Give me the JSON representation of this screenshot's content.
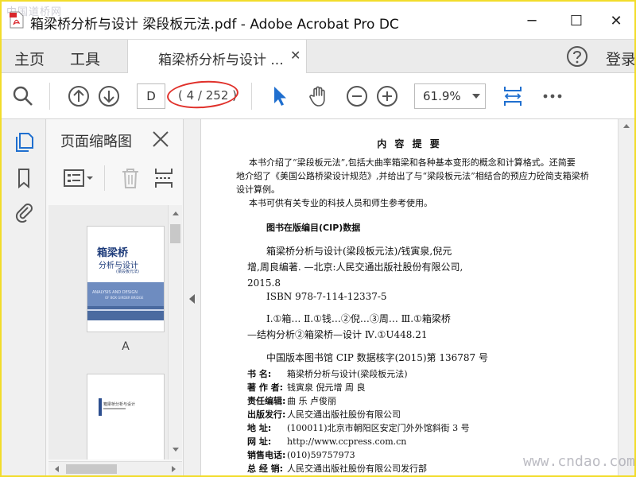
{
  "watermark_top": "中国道桥网",
  "watermark_bottom": "www.cndao.com",
  "window": {
    "title": "箱梁桥分析与设计 梁段板元法.pdf - Adobe Acrobat Pro DC",
    "minimize": "─",
    "maximize": "☐",
    "close": "✕"
  },
  "menubar": {
    "home": "主页",
    "tools": "工具",
    "doc_tab": "箱梁桥分析与设计 ...",
    "doc_tab_close": "✕",
    "signin": "登录"
  },
  "toolbar": {
    "page_input": "D",
    "page_count": "( 4 / 252 )",
    "zoom": "61.9%"
  },
  "panel": {
    "title": "页面缩略图",
    "thumb1_label": "A",
    "thumb1_title": "箱梁桥",
    "thumb1_subtitle": "分析与设计",
    "thumb1_note": "(梁段板元法)",
    "thumb1_en": "ANALYSIS AND DESIGN",
    "thumb1_en2": "OF BOX GIRDER BRIDGE",
    "thumb2_text": "箱梁桥分析与设计"
  },
  "colors": {
    "accent_blue": "#1f6fcf",
    "highlight_red": "#e0302a",
    "frame_yellow": "#f2dc2a"
  },
  "document": {
    "heading": "内 容 提 要",
    "summary": [
      "本书介绍了“梁段板元法”,包括大曲率箱梁和各种基本变形的概念和计算格式。还简要",
      "地介绍了《美国公路桥梁设计规范》,并给出了与“梁段板元法”相结合的预应力砼简支箱梁桥",
      "设计算例。",
      "本书可供有关专业的科技人员和师生参考使用。"
    ],
    "cip_heading": "图书在版编目(CIP)数据",
    "cip_lines": [
      "箱梁桥分析与设计(梁段板元法)/钱寅泉,倪元",
      "增,周良编著. —北京:人民交通出版社股份有限公司,",
      "2015.8",
      "ISBN 978-7-114-12337-5",
      "Ⅰ.①箱…  Ⅱ.①钱…②倪…③周…  Ⅲ.①箱梁桥",
      "—结构分析②箱梁桥—设计  Ⅳ.①U448.21",
      "中国版本图书馆 CIP 数据核字(2015)第 136787 号"
    ],
    "info": [
      {
        "label": "书      名:",
        "value": "箱梁桥分析与设计(梁段板元法)"
      },
      {
        "label": "著 作 者:",
        "value": "钱寅泉  倪元增  周  良"
      },
      {
        "label": "责任编辑:",
        "value": "曲  乐  卢俊丽"
      },
      {
        "label": "出版发行:",
        "value": "人民交通出版社股份有限公司"
      },
      {
        "label": "地      址:",
        "value": "(100011)北京市朝阳区安定门外外馆斜街 3 号"
      },
      {
        "label": "网      址:",
        "value": "http://www.ccpress.com.cn"
      },
      {
        "label": "销售电话:",
        "value": "(010)59757973"
      },
      {
        "label": "总 经 销:",
        "value": "人民交通出版社股份有限公司发行部"
      }
    ]
  }
}
